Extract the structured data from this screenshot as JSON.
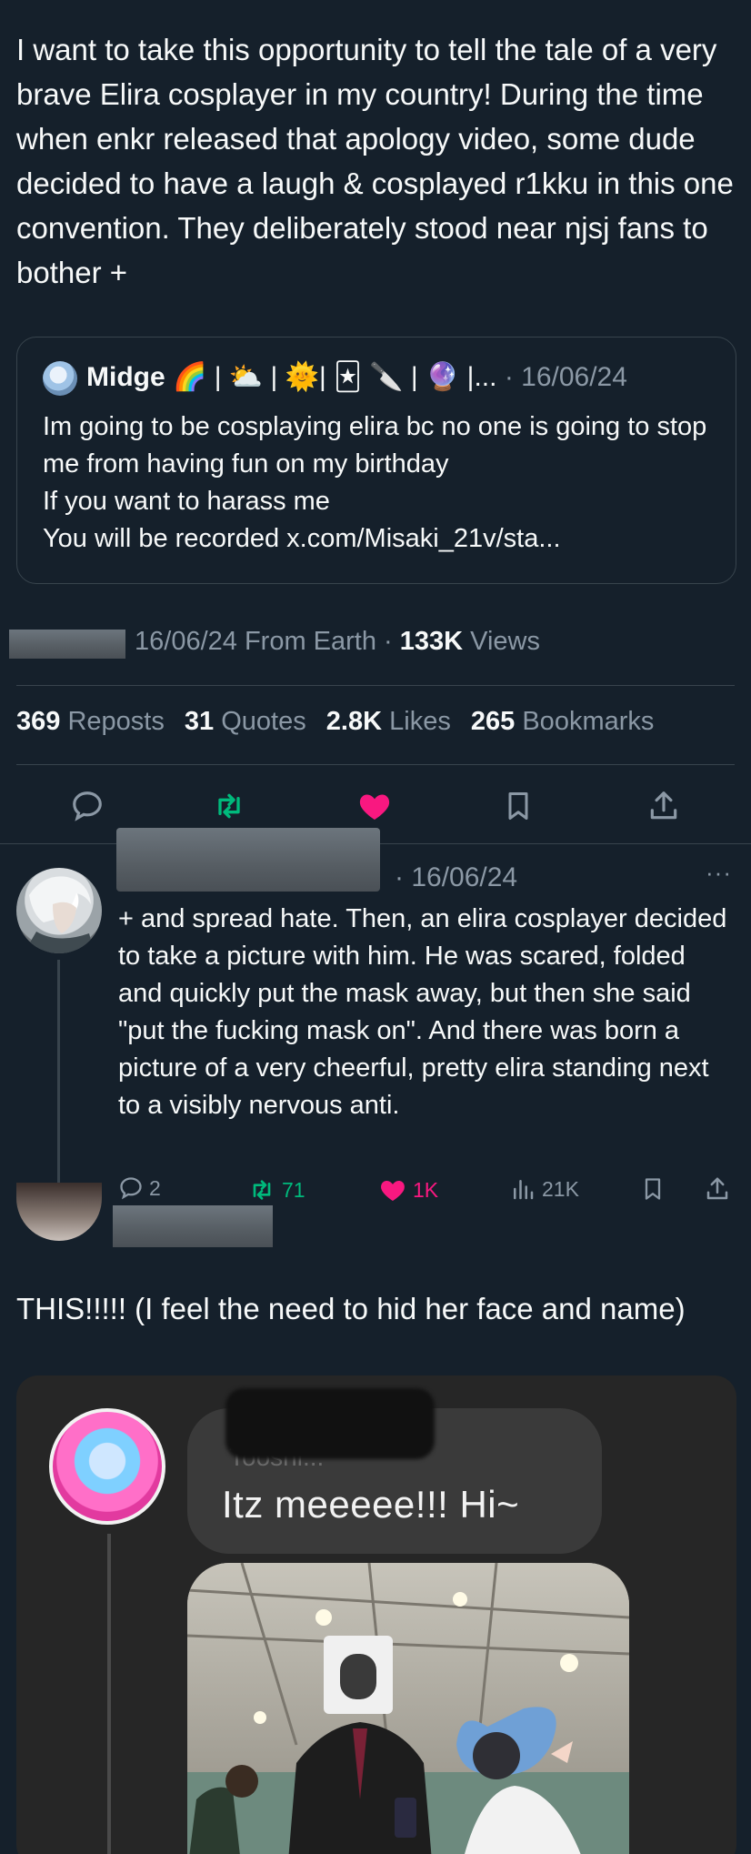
{
  "tweet": {
    "text": "I want to take this opportunity to tell the tale of a very brave Elira cosplayer in my country! During the time when enkr released that apology video, some  dude decided to have a laugh & cosplayed r1kku in this one convention. They deliberately stood near njsj fans to bother +",
    "quoted": {
      "name": "Midge",
      "emojis": "🌈 | ⛅ | 🌞| 🃏 🔪 | 🔮 |...",
      "date": "· 16/06/24",
      "text": "Im going to be cosplaying elira bc no one is going to stop me from having fun on my birthday\nIf you want to harass me\nYou will be recorded x.com/Misaki_21v/sta..."
    },
    "meta": {
      "date_location": "16/06/24 From Earth ·",
      "views_count": "133K",
      "views_label": "Views"
    },
    "stats": [
      {
        "count": "369",
        "label": "Reposts"
      },
      {
        "count": "31",
        "label": "Quotes"
      },
      {
        "count": "2.8K",
        "label": "Likes"
      },
      {
        "count": "265",
        "label": "Bookmarks"
      }
    ],
    "actions": [
      "reply-icon",
      "retweet-icon",
      "like-icon",
      "bookmark-icon",
      "share-icon"
    ],
    "colors": {
      "retweet": "#00ba7c",
      "like": "#f91880",
      "muted": "#8b98a5",
      "background": "#15202b"
    }
  },
  "reply": {
    "date": "· 16/06/24",
    "more": "···",
    "text": "+ and spread hate. Then, an elira cosplayer decided to take a picture with him. He was scared, folded and quickly put the mask away, but then she said \"put the fucking mask on\". And there was born a picture of a very cheerful, pretty elira standing next to a visibly nervous anti.",
    "actions": {
      "replies": "2",
      "reposts": "71",
      "likes": "1K",
      "views": "21K"
    }
  },
  "second_post": {
    "text": "THIS!!!!! (I feel the need to hid her face and name)",
    "card": {
      "bubble_name": "Tooshi...",
      "bubble_text": "Itz meeeee!!! Hi~"
    }
  }
}
